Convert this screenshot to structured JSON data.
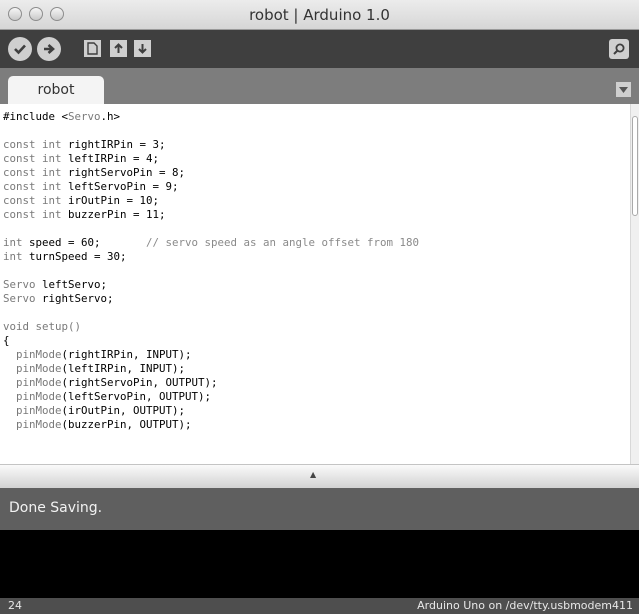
{
  "window": {
    "title": "robot | Arduino 1.0"
  },
  "toolbar": {
    "buttons": [
      {
        "name": "verify",
        "icon": "check-icon"
      },
      {
        "name": "upload",
        "icon": "arrow-right-icon"
      },
      {
        "name": "new",
        "icon": "document-icon"
      },
      {
        "name": "open",
        "icon": "arrow-up-icon"
      },
      {
        "name": "save",
        "icon": "arrow-down-icon"
      },
      {
        "name": "serial-monitor",
        "icon": "magnifier-icon"
      }
    ]
  },
  "tabs": [
    {
      "label": "robot",
      "active": true
    }
  ],
  "editor": {
    "lines": [
      [
        {
          "t": "#include <",
          "c": "n"
        },
        {
          "t": "Servo",
          "c": "k"
        },
        {
          "t": ".h>",
          "c": "n"
        }
      ],
      [],
      [
        {
          "t": "const int ",
          "c": "k"
        },
        {
          "t": "rightIRPin = 3;",
          "c": "n"
        }
      ],
      [
        {
          "t": "const int ",
          "c": "k"
        },
        {
          "t": "leftIRPin = 4;",
          "c": "n"
        }
      ],
      [
        {
          "t": "const int ",
          "c": "k"
        },
        {
          "t": "rightServoPin = 8;",
          "c": "n"
        }
      ],
      [
        {
          "t": "const int ",
          "c": "k"
        },
        {
          "t": "leftServoPin = 9;",
          "c": "n"
        }
      ],
      [
        {
          "t": "const int ",
          "c": "k"
        },
        {
          "t": "irOutPin = 10;",
          "c": "n"
        }
      ],
      [
        {
          "t": "const int ",
          "c": "k"
        },
        {
          "t": "buzzerPin = 11;",
          "c": "n"
        }
      ],
      [],
      [
        {
          "t": "int ",
          "c": "k"
        },
        {
          "t": "speed = 60;       ",
          "c": "n"
        },
        {
          "t": "// servo speed as an angle offset from 180",
          "c": "cm"
        }
      ],
      [
        {
          "t": "int ",
          "c": "k"
        },
        {
          "t": "turnSpeed = 30;",
          "c": "n"
        }
      ],
      [],
      [
        {
          "t": "Servo ",
          "c": "k"
        },
        {
          "t": "leftServo;",
          "c": "n"
        }
      ],
      [
        {
          "t": "Servo ",
          "c": "k"
        },
        {
          "t": "rightServo;",
          "c": "n"
        }
      ],
      [],
      [
        {
          "t": "void setup()",
          "c": "k"
        }
      ],
      [
        {
          "t": "{",
          "c": "n"
        }
      ],
      [
        {
          "t": "  pinMode",
          "c": "k"
        },
        {
          "t": "(rightIRPin, INPUT);",
          "c": "n"
        }
      ],
      [
        {
          "t": "  pinMode",
          "c": "k"
        },
        {
          "t": "(leftIRPin, INPUT);",
          "c": "n"
        }
      ],
      [
        {
          "t": "  pinMode",
          "c": "k"
        },
        {
          "t": "(rightServoPin, OUTPUT);",
          "c": "n"
        }
      ],
      [
        {
          "t": "  pinMode",
          "c": "k"
        },
        {
          "t": "(leftServoPin, OUTPUT);",
          "c": "n"
        }
      ],
      [
        {
          "t": "  pinMode",
          "c": "k"
        },
        {
          "t": "(irOutPin, OUTPUT);",
          "c": "n"
        }
      ],
      [
        {
          "t": "  pinMode",
          "c": "k"
        },
        {
          "t": "(buzzerPin, OUTPUT);",
          "c": "n"
        }
      ]
    ]
  },
  "status": {
    "message": "Done Saving."
  },
  "footer": {
    "line_number": "24",
    "board": "Arduino Uno on /dev/tty.usbmodem411"
  }
}
